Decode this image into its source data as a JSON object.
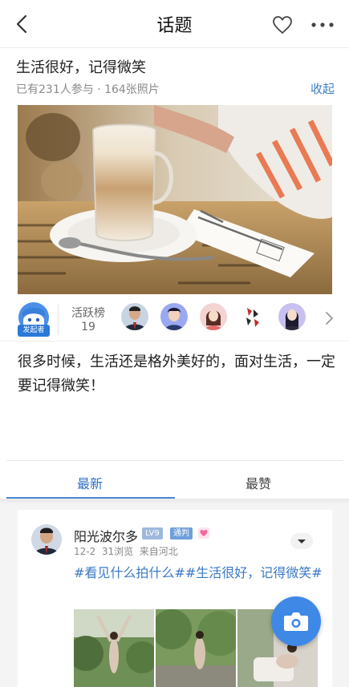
{
  "header": {
    "title": "话题",
    "back_icon": "chevron-left-icon",
    "favorite_icon": "heart-outline-icon",
    "more_icon": "more-dots-icon"
  },
  "topic": {
    "title": "生活很好，记得微笑",
    "meta": "已有231人参与 · 164张照片",
    "collapse_label": "收起",
    "hero_image": "latte-glass-on-cafe-table-photo"
  },
  "participants": {
    "initiator_badge": "发起者",
    "rank_label": "活跃榜",
    "rank_count": "19",
    "avatars": [
      "avatar-man-suit",
      "avatar-cartoon-boy",
      "avatar-cartoon-girl",
      "avatar-calligraphy",
      "avatar-cartoon-woman"
    ],
    "arrow_icon": "chevron-right-icon"
  },
  "description": "很多时候，生活还是格外美好的，面对生活，一定要记得微笑！",
  "tabs": [
    {
      "label": "最新",
      "active": true
    },
    {
      "label": "最赞",
      "active": false
    }
  ],
  "colors": {
    "accent": "#2e6fc5",
    "link": "#3a78c5",
    "fab": "#3f88e6",
    "badge_lv": "#9fb9dc",
    "heart": "#f06aa0"
  },
  "post": {
    "username": "阳光波尔多",
    "level_badge": "LV9",
    "tag_badge": "通判",
    "time": "12-2",
    "views": "31浏览",
    "location": "来自河北",
    "text": "#看见什么拍什么##生活很好，记得微笑#",
    "images": [
      "woman-arms-raised-forest-photo",
      "woman-walking-forest-photo",
      "woman-sitting-chair-photo"
    ]
  },
  "fab": {
    "icon": "camera-icon"
  }
}
